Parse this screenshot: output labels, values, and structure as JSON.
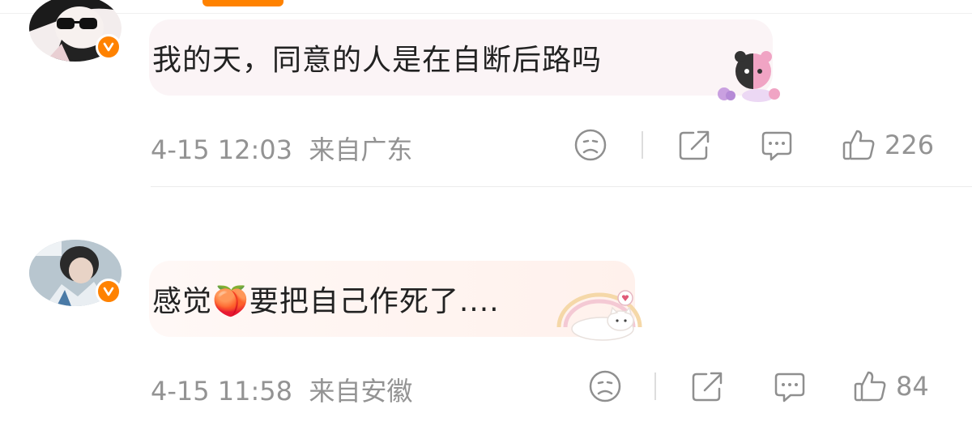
{
  "colors": {
    "accent": "#ff8200",
    "meta_text": "#939393",
    "bubble_1": "#fbf4f6",
    "bubble_2": "#fff3ee"
  },
  "comments": [
    {
      "text": "我的天，同意的人是在自断后路吗",
      "time": "4-15 12:03",
      "location": "来自广东",
      "likes": "226",
      "verified": true,
      "icons": [
        "sad-face-icon",
        "share-icon",
        "comment-icon",
        "thumbs-up-icon"
      ]
    },
    {
      "text": "感觉🍑要把自己作死了....",
      "time": "4-15 11:58",
      "location": "来自安徽",
      "likes": "84",
      "verified": true,
      "icons": [
        "sad-face-icon",
        "share-icon",
        "comment-icon",
        "thumbs-up-icon"
      ]
    }
  ]
}
